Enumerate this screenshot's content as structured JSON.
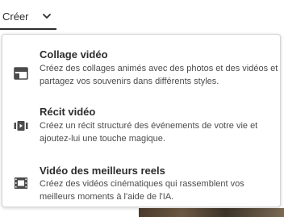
{
  "create_button": {
    "label": "Créer",
    "icon": "chevron-down-icon"
  },
  "menu": {
    "items": [
      {
        "title": "Collage vidéo",
        "description_lines": [
          "Créez des collages animés avec des photos et des vidéos et",
          "partagez vos souvenirs dans différents styles."
        ],
        "icon": "video-collage-icon"
      },
      {
        "title": "Récit vidéo",
        "description_lines": [
          "Créez un récit structuré des événements de votre vie et",
          "ajoutez-lui une touche magique."
        ],
        "icon": "video-story-icon"
      },
      {
        "title": "Vidéo des meilleurs reels",
        "description_lines": [
          "Créez des vidéos cinématiques qui rassemblent vos",
          "meilleurs moments à l'aide de l'IA."
        ],
        "icon": "film-strip-icon"
      }
    ]
  }
}
